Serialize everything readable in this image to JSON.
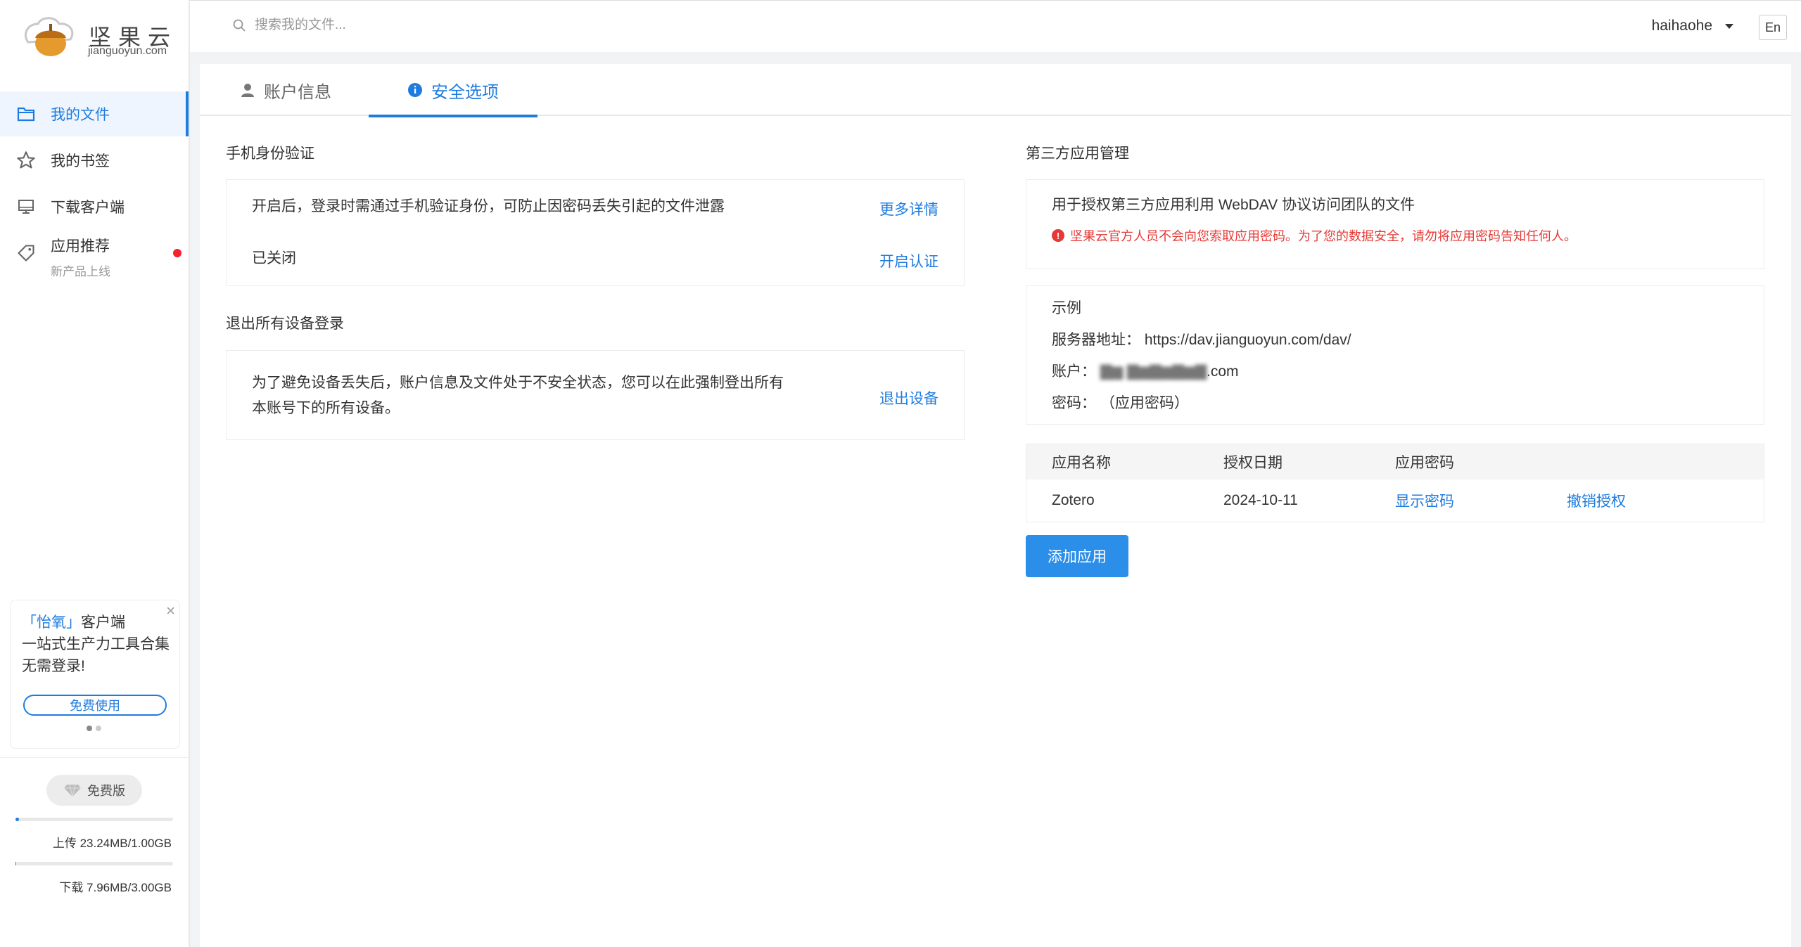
{
  "brand": {
    "name_cn": "坚果云",
    "name_en": "jianguoyun.com"
  },
  "sidebar": {
    "items": [
      {
        "label": "我的文件",
        "icon": "folder-icon",
        "active": true
      },
      {
        "label": "我的书签",
        "icon": "star-icon"
      },
      {
        "label": "下载客户端",
        "icon": "monitor-icon"
      },
      {
        "label": "应用推荐",
        "sub": "新产品上线",
        "icon": "tag-icon",
        "badge": "red-dot"
      }
    ],
    "promo": {
      "highlight": "「怡氧」",
      "title_rest": "客户端",
      "body": "一站式生产力工具合集 无需登录!",
      "button": "免费使用"
    },
    "plan": "免费版",
    "upload": {
      "label": "上传 23.24MB/1.00GB",
      "fraction": 0.0227
    },
    "download": {
      "label": "下载 7.96MB/3.00GB",
      "fraction": 0.0026
    }
  },
  "topbar": {
    "search_placeholder": "搜索我的文件...",
    "username": "haihaohe",
    "lang": "En"
  },
  "tabs": [
    {
      "label": "账户信息",
      "icon": "user-icon"
    },
    {
      "label": "安全选项",
      "icon": "info-icon",
      "active": true
    }
  ],
  "left": {
    "phone_auth": {
      "title": "手机身份验证",
      "desc": "开启后，登录时需通过手机验证身份，可防止因密码丢失引起的文件泄露",
      "more_link": "更多详情",
      "status": "已关闭",
      "enable_link": "开启认证"
    },
    "logout_all": {
      "title": "退出所有设备登录",
      "desc_line1": "为了避免设备丢失后，账户信息及文件处于不安全状态，您可以在此强制登出所有",
      "desc_line2": "本账号下的所有设备。",
      "link": "退出设备"
    }
  },
  "right": {
    "title": "第三方应用管理",
    "intro": "用于授权第三方应用利用 WebDAV 协议访问团队的文件",
    "warning": "坚果云官方人员不会向您索取应用密码。为了您的数据安全，请勿将应用密码告知任何人。",
    "example": {
      "title": "示例",
      "server_label": "服务器地址：",
      "server_value": "https://dav.jianguoyun.com/dav/",
      "account_label": "账户：",
      "account_suffix": ".com",
      "password_label": "密码：",
      "password_value": "（应用密码）"
    },
    "table": {
      "headers": [
        "应用名称",
        "授权日期",
        "应用密码"
      ],
      "rows": [
        {
          "name": "Zotero",
          "date": "2024-10-11",
          "show": "显示密码",
          "revoke": "撤销授权"
        }
      ]
    },
    "add_button": "添加应用"
  },
  "colors": {
    "accent": "#1f7cdf",
    "danger": "#e53935",
    "button": "#2b8ee8"
  }
}
